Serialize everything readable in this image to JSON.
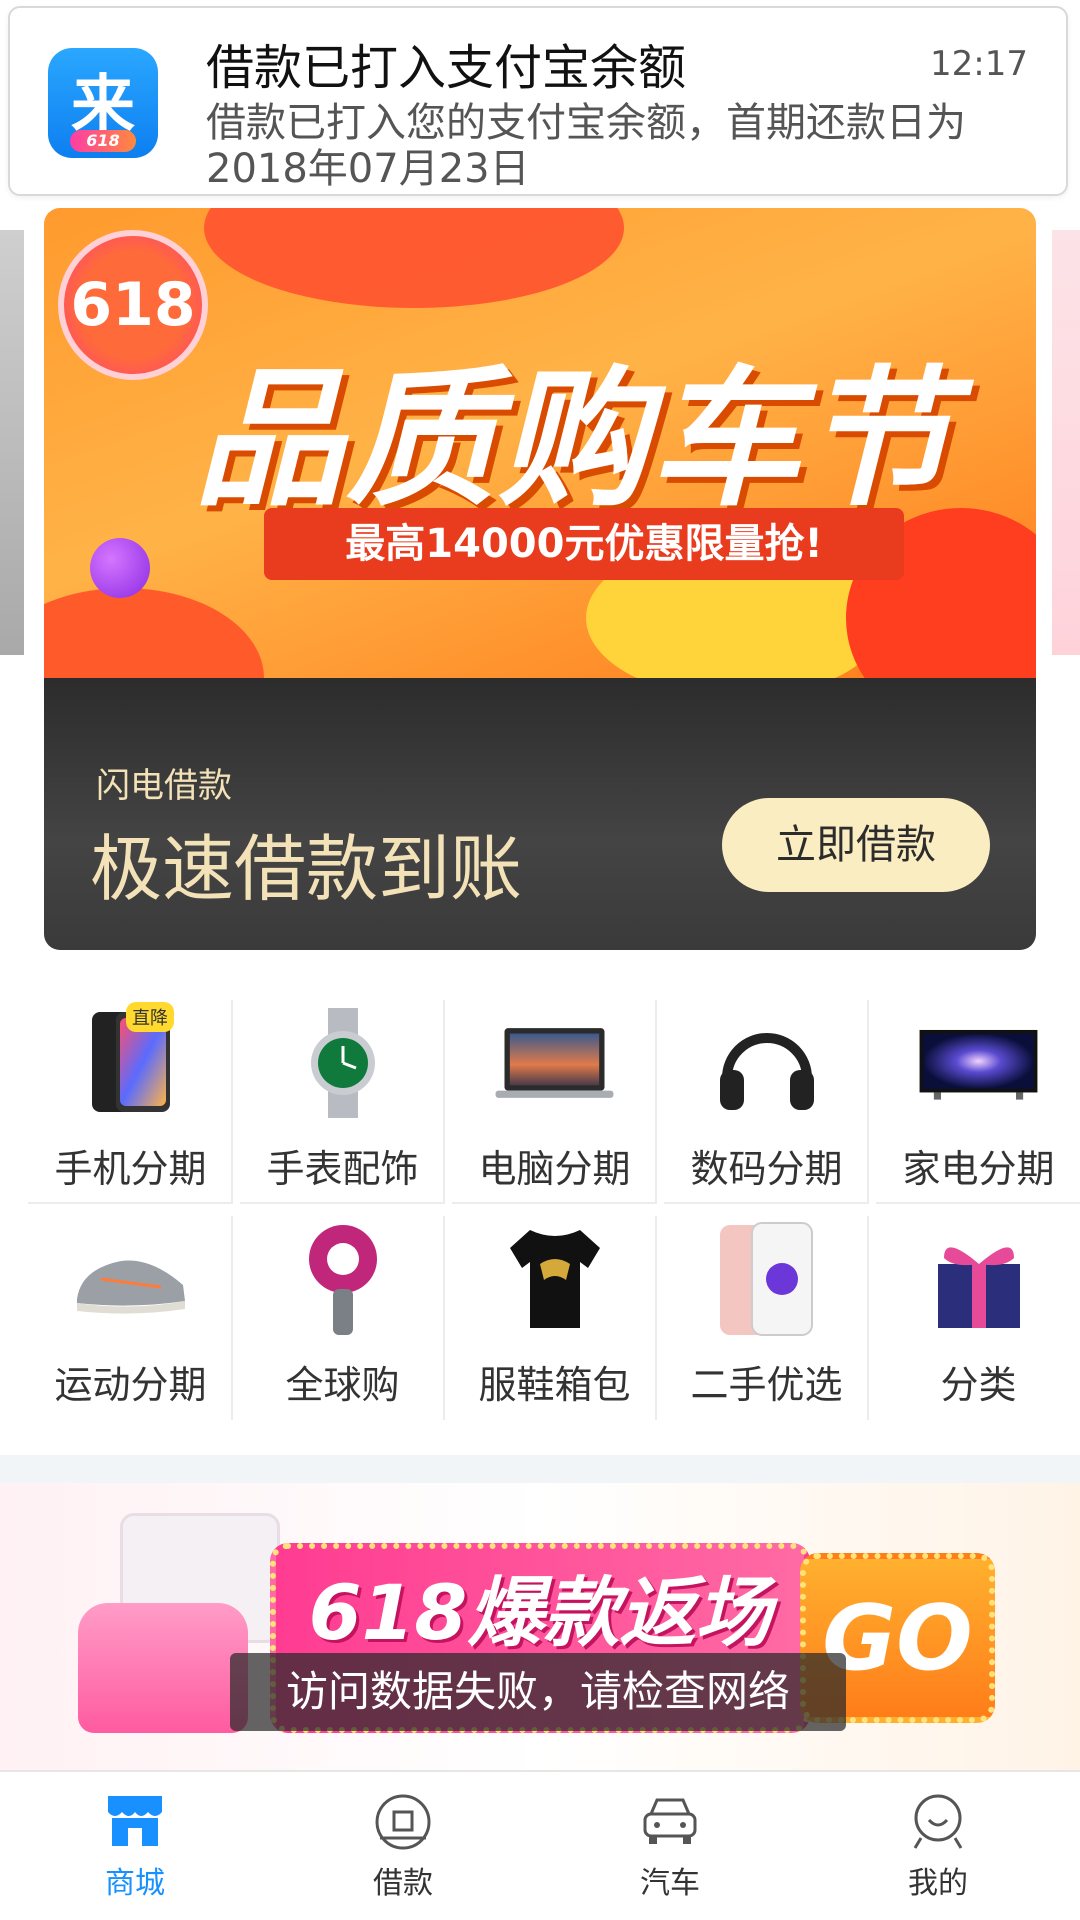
{
  "notification": {
    "app_icon_char": "来",
    "app_icon_badge": "618",
    "title": "借款已打入支付宝余额",
    "time": "12:17",
    "body": "借款已打入您的支付宝余额，首期还款日为2018年07月23日"
  },
  "hero_banner": {
    "logo": "618",
    "headline": "品质购车节",
    "subline": "最高14000元优惠限量抢!"
  },
  "loan_card": {
    "small_title": "闪电借款",
    "big_title": "极速借款到账",
    "button": "立即借款"
  },
  "categories": [
    {
      "label": "手机分期",
      "tag": "直降",
      "icon": "phone-icon"
    },
    {
      "label": "手表配饰",
      "icon": "watch-icon"
    },
    {
      "label": "电脑分期",
      "icon": "laptop-icon"
    },
    {
      "label": "数码分期",
      "icon": "headphones-icon"
    },
    {
      "label": "家电分期",
      "icon": "tv-icon"
    },
    {
      "label": "运动分期",
      "icon": "sneaker-icon"
    },
    {
      "label": "全球购",
      "icon": "hairdryer-icon"
    },
    {
      "label": "服鞋箱包",
      "icon": "tshirt-icon"
    },
    {
      "label": "二手优选",
      "icon": "used-phone-icon"
    },
    {
      "label": "分类",
      "icon": "gift-icon"
    }
  ],
  "promo": {
    "title": "618爆款返场",
    "go": "GO",
    "toast": "访问数据失败，请检查网络"
  },
  "tabs": [
    {
      "label": "商城",
      "icon": "store-icon",
      "active": true
    },
    {
      "label": "借款",
      "icon": "loan-icon",
      "active": false
    },
    {
      "label": "汽车",
      "icon": "car-icon",
      "active": false
    },
    {
      "label": "我的",
      "icon": "profile-icon",
      "active": false
    }
  ],
  "colors": {
    "accent": "#1890ff",
    "loan_gold": "#f3e2b8",
    "tag_yellow": "#ffd92e"
  }
}
